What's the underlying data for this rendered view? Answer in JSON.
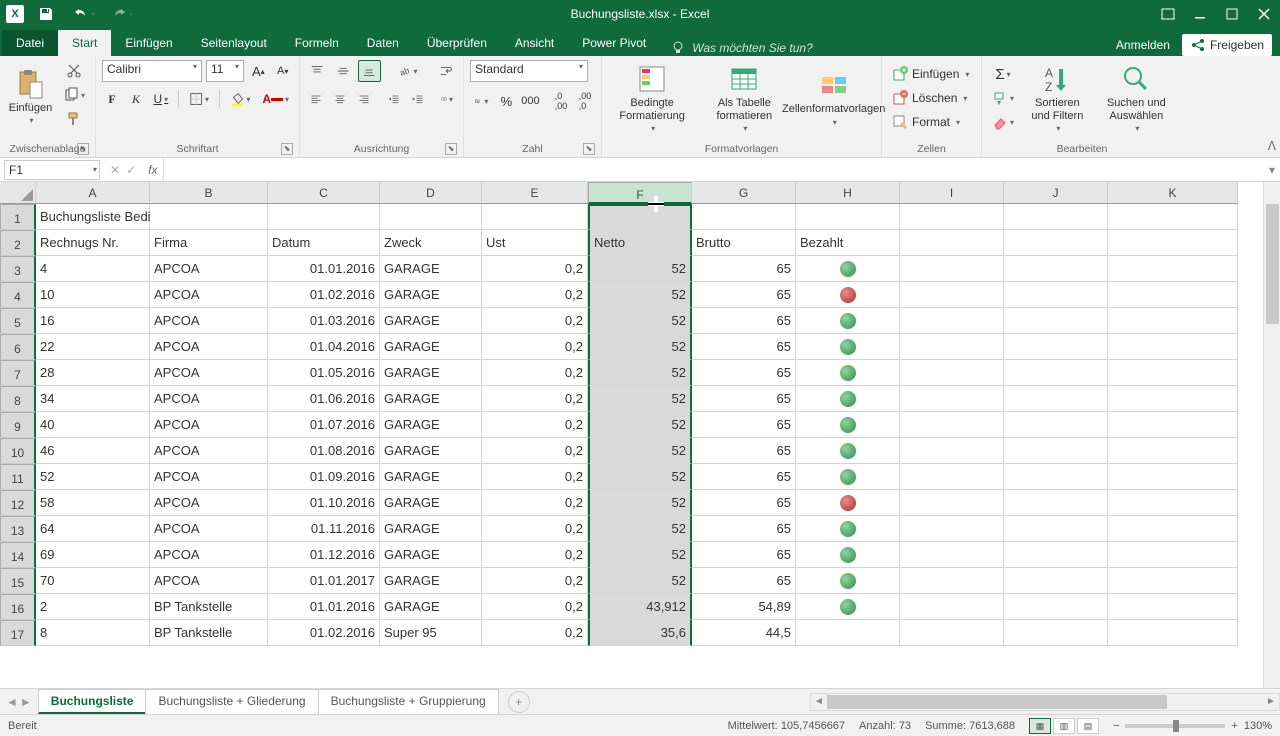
{
  "titlebar": {
    "title": "Buchungsliste.xlsx - Excel"
  },
  "ribbon_tabs": {
    "file": "Datei",
    "tabs": [
      "Start",
      "Einfügen",
      "Seitenlayout",
      "Formeln",
      "Daten",
      "Überprüfen",
      "Ansicht",
      "Power Pivot"
    ],
    "active": "Start",
    "tell_me": "Was möchten Sie tun?",
    "sign_in": "Anmelden",
    "share": "Freigeben"
  },
  "ribbon": {
    "clipboard": {
      "paste": "Einfügen",
      "label": "Zwischenablage"
    },
    "font": {
      "name": "Calibri",
      "size": "11",
      "label": "Schriftart"
    },
    "alignment": {
      "label": "Ausrichtung"
    },
    "number": {
      "format": "Standard",
      "label": "Zahl"
    },
    "styles": {
      "cond": "Bedingte Formatierung",
      "table": "Als Tabelle formatieren",
      "cell": "Zellenformatvorlagen",
      "label": "Formatvorlagen"
    },
    "cells": {
      "insert": "Einfügen",
      "delete": "Löschen",
      "format": "Format",
      "label": "Zellen"
    },
    "editing": {
      "sort": "Sortieren und Filtern",
      "find": "Suchen und Auswählen",
      "label": "Bearbeiten"
    }
  },
  "namebox": "F1",
  "columns": [
    {
      "l": "A",
      "w": 114
    },
    {
      "l": "B",
      "w": 118
    },
    {
      "l": "C",
      "w": 112
    },
    {
      "l": "D",
      "w": 102
    },
    {
      "l": "E",
      "w": 106
    },
    {
      "l": "F",
      "w": 104,
      "selected": true
    },
    {
      "l": "G",
      "w": 104
    },
    {
      "l": "H",
      "w": 104
    },
    {
      "l": "I",
      "w": 104
    },
    {
      "l": "J",
      "w": 104
    },
    {
      "l": "K",
      "w": 130
    }
  ],
  "row1_title": "Buchungsliste Bedingte Formatierung",
  "headers": [
    "Rechnugs Nr.",
    "Firma",
    "Datum",
    "Zweck",
    "Ust",
    "Netto",
    "Brutto",
    "Bezahlt"
  ],
  "rows": [
    {
      "n": "4",
      "firma": "APCOA",
      "datum": "01.01.2016",
      "zweck": "GARAGE",
      "ust": "0,2",
      "netto": "52",
      "brutto": "65",
      "status": "green"
    },
    {
      "n": "10",
      "firma": "APCOA",
      "datum": "01.02.2016",
      "zweck": "GARAGE",
      "ust": "0,2",
      "netto": "52",
      "brutto": "65",
      "status": "red"
    },
    {
      "n": "16",
      "firma": "APCOA",
      "datum": "01.03.2016",
      "zweck": "GARAGE",
      "ust": "0,2",
      "netto": "52",
      "brutto": "65",
      "status": "green"
    },
    {
      "n": "22",
      "firma": "APCOA",
      "datum": "01.04.2016",
      "zweck": "GARAGE",
      "ust": "0,2",
      "netto": "52",
      "brutto": "65",
      "status": "green"
    },
    {
      "n": "28",
      "firma": "APCOA",
      "datum": "01.05.2016",
      "zweck": "GARAGE",
      "ust": "0,2",
      "netto": "52",
      "brutto": "65",
      "status": "green"
    },
    {
      "n": "34",
      "firma": "APCOA",
      "datum": "01.06.2016",
      "zweck": "GARAGE",
      "ust": "0,2",
      "netto": "52",
      "brutto": "65",
      "status": "green"
    },
    {
      "n": "40",
      "firma": "APCOA",
      "datum": "01.07.2016",
      "zweck": "GARAGE",
      "ust": "0,2",
      "netto": "52",
      "brutto": "65",
      "status": "green"
    },
    {
      "n": "46",
      "firma": "APCOA",
      "datum": "01.08.2016",
      "zweck": "GARAGE",
      "ust": "0,2",
      "netto": "52",
      "brutto": "65",
      "status": "green"
    },
    {
      "n": "52",
      "firma": "APCOA",
      "datum": "01.09.2016",
      "zweck": "GARAGE",
      "ust": "0,2",
      "netto": "52",
      "brutto": "65",
      "status": "green"
    },
    {
      "n": "58",
      "firma": "APCOA",
      "datum": "01.10.2016",
      "zweck": "GARAGE",
      "ust": "0,2",
      "netto": "52",
      "brutto": "65",
      "status": "red"
    },
    {
      "n": "64",
      "firma": "APCOA",
      "datum": "01.11.2016",
      "zweck": "GARAGE",
      "ust": "0,2",
      "netto": "52",
      "brutto": "65",
      "status": "green"
    },
    {
      "n": "69",
      "firma": "APCOA",
      "datum": "01.12.2016",
      "zweck": "GARAGE",
      "ust": "0,2",
      "netto": "52",
      "brutto": "65",
      "status": "green"
    },
    {
      "n": "70",
      "firma": "APCOA",
      "datum": "01.01.2017",
      "zweck": "GARAGE",
      "ust": "0,2",
      "netto": "52",
      "brutto": "65",
      "status": "green"
    },
    {
      "n": "2",
      "firma": "BP Tankstelle",
      "datum": "01.01.2016",
      "zweck": "GARAGE",
      "ust": "0,2",
      "netto": "43,912",
      "brutto": "54,89",
      "status": "green"
    },
    {
      "n": "8",
      "firma": "BP Tankstelle",
      "datum": "01.02.2016",
      "zweck": "Super 95",
      "ust": "0,2",
      "netto": "35,6",
      "brutto": "44,5",
      "status": ""
    }
  ],
  "sheet_tabs": {
    "tabs": [
      "Buchungsliste",
      "Buchungsliste + Gliederung",
      "Buchungsliste + Gruppierung"
    ],
    "active": 0
  },
  "statusbar": {
    "ready": "Bereit",
    "avg_label": "Mittelwert:",
    "avg": "105,7456667",
    "count_label": "Anzahl:",
    "count": "73",
    "sum_label": "Summe:",
    "sum": "7613,688",
    "zoom": "130%"
  }
}
